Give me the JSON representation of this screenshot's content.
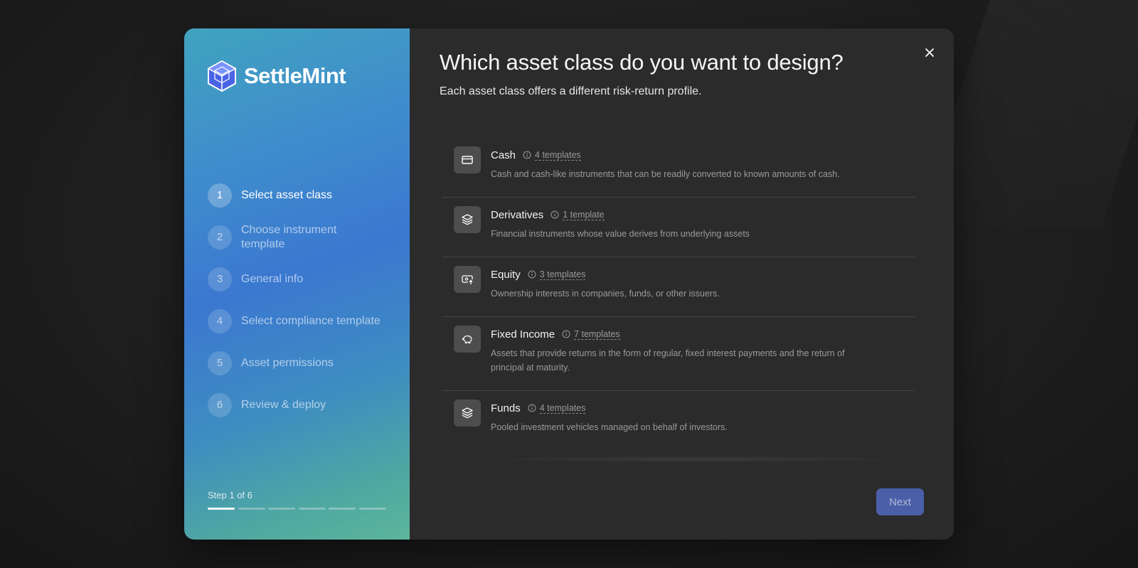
{
  "brand": {
    "name": "SettleMint"
  },
  "steps": [
    {
      "number": "1",
      "label": "Select asset class",
      "active": true
    },
    {
      "number": "2",
      "label": "Choose instrument template",
      "active": false
    },
    {
      "number": "3",
      "label": "General info",
      "active": false
    },
    {
      "number": "4",
      "label": "Select compliance template",
      "active": false
    },
    {
      "number": "5",
      "label": "Asset permissions",
      "active": false
    },
    {
      "number": "6",
      "label": "Review & deploy",
      "active": false
    }
  ],
  "progress": {
    "label": "Step 1 of 6",
    "current": 1,
    "total": 6
  },
  "main": {
    "title": "Which asset class do you want to design?",
    "subtitle": "Each asset class offers a different risk-return profile."
  },
  "asset_classes": [
    {
      "name": "Cash",
      "templates": "4 templates",
      "icon": "credit-card-icon",
      "description": "Cash and cash-like instruments that can be readily converted to known amounts of cash."
    },
    {
      "name": "Derivatives",
      "templates": "1 template",
      "icon": "layers-icon",
      "description": "Financial instruments whose value derives from underlying assets"
    },
    {
      "name": "Equity",
      "templates": "3 templates",
      "icon": "banknote-arrow-icon",
      "description": "Ownership interests in companies, funds, or other issuers."
    },
    {
      "name": "Fixed Income",
      "templates": "7 templates",
      "icon": "piggy-bank-icon",
      "description": "Assets that provide returns in the form of regular, fixed interest payments and the return of principal at maturity."
    },
    {
      "name": "Funds",
      "templates": "4 templates",
      "icon": "layers-icon",
      "description": "Pooled investment vehicles managed on behalf of investors."
    }
  ],
  "actions": {
    "next_label": "Next"
  },
  "colors": {
    "accent": "#4a5fa8",
    "panel": "#2b2b2b",
    "sidebar_start": "#41a3bf",
    "sidebar_end": "#5cb59a"
  }
}
